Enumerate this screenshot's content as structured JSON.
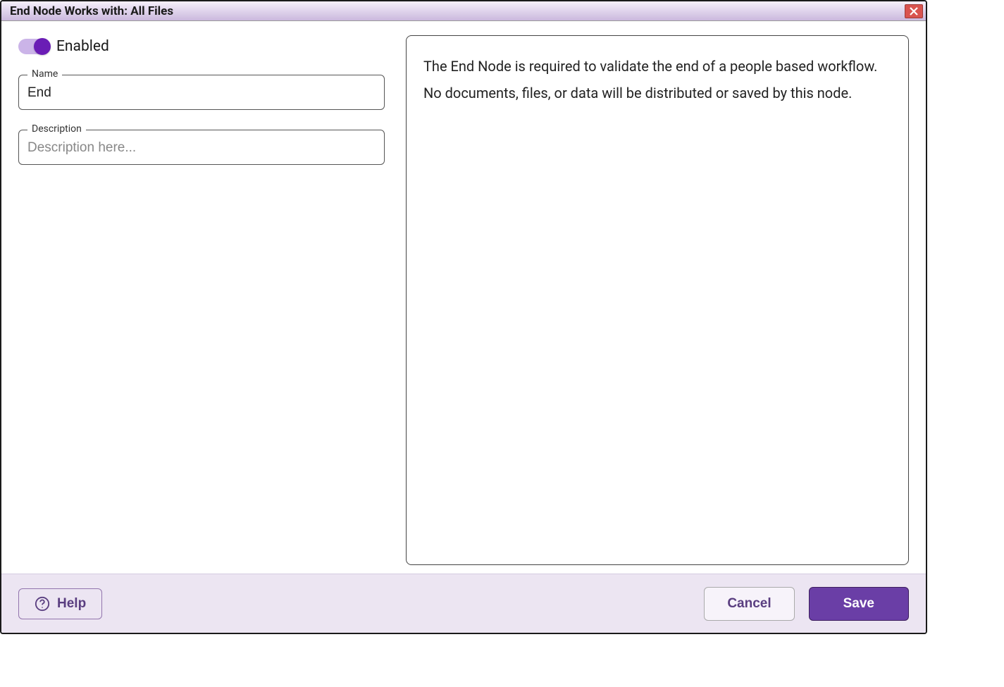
{
  "titleBar": {
    "title": "End Node Works with: All Files"
  },
  "form": {
    "toggleLabel": "Enabled",
    "nameLabel": "Name",
    "nameValue": "End",
    "descriptionLabel": "Description",
    "descriptionPlaceholder": "Description here..."
  },
  "info": {
    "text": "The End Node is required to validate the end of a people based workflow. No documents, files, or data will be distributed or saved by this node."
  },
  "footer": {
    "helpLabel": "Help",
    "cancelLabel": "Cancel",
    "saveLabel": "Save"
  }
}
